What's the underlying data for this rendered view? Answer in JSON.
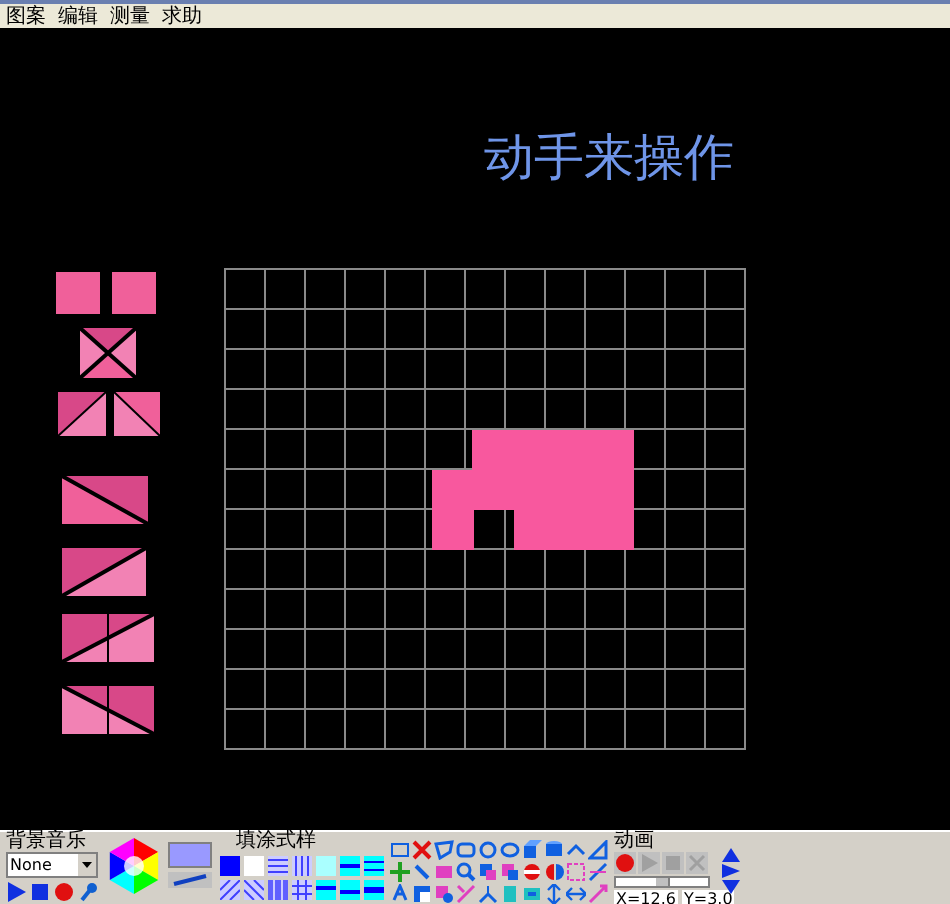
{
  "menu": [
    {
      "label": "图案"
    },
    {
      "label": "编辑"
    },
    {
      "label": "测量"
    },
    {
      "label": "求助"
    }
  ],
  "title": "动手来操作",
  "music": {
    "label": "背景音乐",
    "track": "None"
  },
  "fill": {
    "label": "填涂式样"
  },
  "animation": {
    "label": "动画",
    "slider": {
      "level": 0.5
    }
  },
  "coordinates": [
    {
      "label": "X=12.6"
    },
    {
      "label": "Y=3.0"
    }
  ]
}
